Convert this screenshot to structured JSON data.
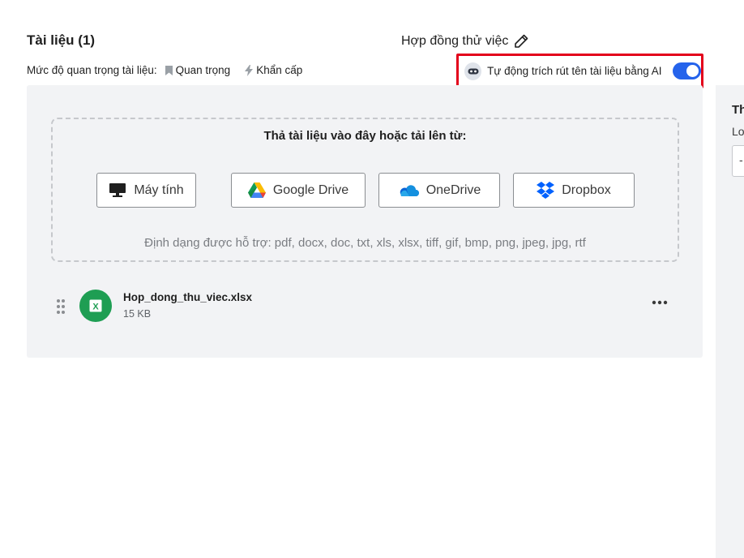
{
  "documents": {
    "title": "Tài liệu (1)",
    "priority_label": "Mức độ quan trọng tài liệu:",
    "priority_options": [
      {
        "label": "Quan trọng",
        "icon": "bookmark-icon"
      },
      {
        "label": "Khẩn cấp",
        "icon": "lightning-icon"
      }
    ]
  },
  "contract": {
    "title": "Hợp đồng thử việc",
    "edit_icon": "pencil-icon"
  },
  "ai_extract": {
    "label": "Tự động trích rút tên tài liệu bằng AI",
    "enabled": true,
    "toggle_color": "#2563eb",
    "highlight_color": "#e3001b"
  },
  "upload": {
    "title": "Thả tài liệu vào đây hoặc tải lên từ:",
    "sources": [
      {
        "label": "Máy tính",
        "icon": "monitor-icon"
      },
      {
        "label": "Google Drive",
        "icon": "google-drive-icon"
      },
      {
        "label": "OneDrive",
        "icon": "onedrive-icon"
      },
      {
        "label": "Dropbox",
        "icon": "dropbox-icon"
      }
    ],
    "formats": "Định dạng được hỗ trợ: pdf, docx, doc, txt, xls, xlsx, tiff, gif, bmp, png, jpeg, jpg, rtf"
  },
  "files": [
    {
      "name": "Hop_dong_thu_viec.xlsx",
      "size": "15 KB",
      "icon_letter": "X",
      "icon_color": "#1e9e53"
    }
  ],
  "right_panel": {
    "title": "Th",
    "sub": "Lo",
    "input_value": "-"
  }
}
